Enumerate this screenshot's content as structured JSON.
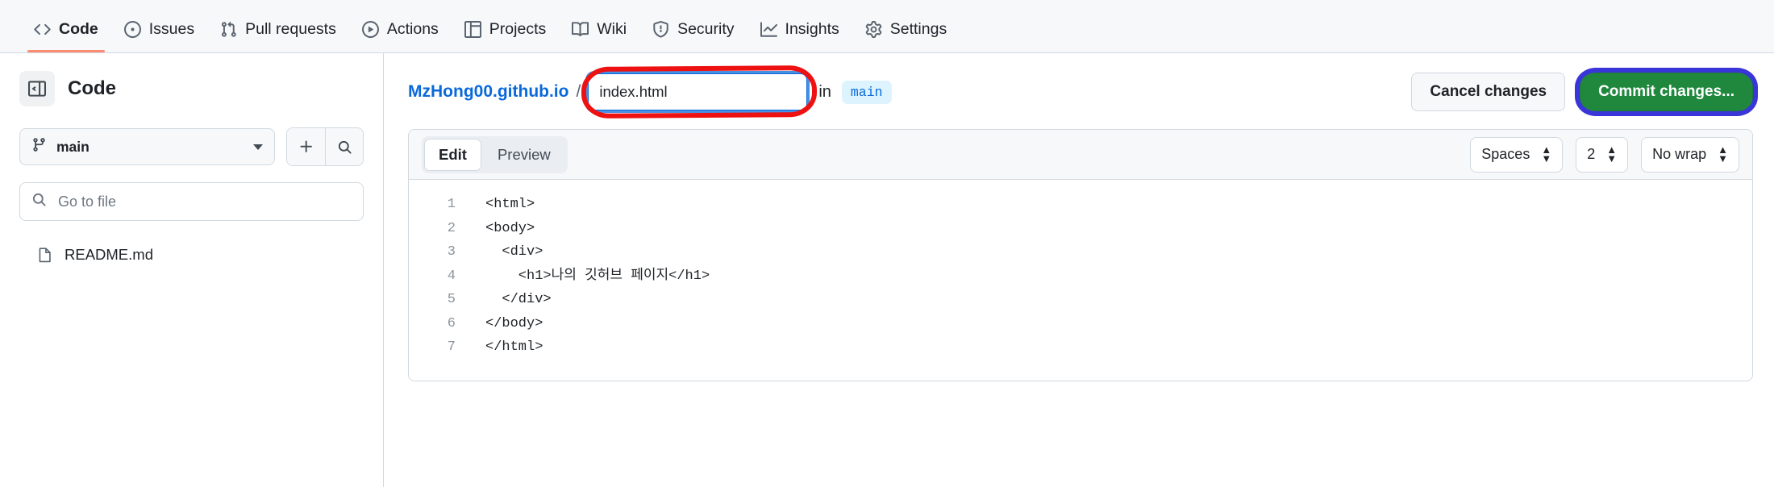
{
  "repo_nav": {
    "items": [
      {
        "label": "Code",
        "icon": "code-icon",
        "active": true
      },
      {
        "label": "Issues",
        "icon": "issue-opened-icon",
        "active": false
      },
      {
        "label": "Pull requests",
        "icon": "git-pull-request-icon",
        "active": false
      },
      {
        "label": "Actions",
        "icon": "play-icon",
        "active": false
      },
      {
        "label": "Projects",
        "icon": "table-icon",
        "active": false
      },
      {
        "label": "Wiki",
        "icon": "book-icon",
        "active": false
      },
      {
        "label": "Security",
        "icon": "shield-icon",
        "active": false
      },
      {
        "label": "Insights",
        "icon": "graph-icon",
        "active": false
      },
      {
        "label": "Settings",
        "icon": "gear-icon",
        "active": false
      }
    ],
    "active_underline_color": "#fd8c73"
  },
  "sidebar": {
    "title": "Code",
    "collapse_icon": "sidebar-collapse-icon",
    "branch": "main",
    "add_icon": "plus-icon",
    "search_icon": "search-icon",
    "file_search_placeholder": "Go to file",
    "files": [
      {
        "name": "README.md",
        "icon": "file-icon"
      }
    ]
  },
  "file_header": {
    "repo_link": "MzHong00.github.io",
    "separator": "/",
    "filename_value": "index.html",
    "filename_placeholder": "Name your file...",
    "in_label": "in",
    "branch_badge": "main",
    "cancel_label": "Cancel changes",
    "commit_label": "Commit changes...",
    "commit_color": "#1f883d",
    "annotation_red_color": "#ee1111",
    "annotation_blue_color": "#3a35d8"
  },
  "editor": {
    "tabs": [
      {
        "label": "Edit",
        "active": true
      },
      {
        "label": "Preview",
        "active": false
      }
    ],
    "indent_mode": "Spaces",
    "indent_size": "2",
    "wrap_mode": "No wrap",
    "line_numbers": [
      "1",
      "2",
      "3",
      "4",
      "5",
      "6",
      "7"
    ],
    "code": "<html>\n<body>\n  <div>\n    <h1>나의 깃허브 페이지</h1>\n  </div>\n</body>\n</html>"
  }
}
